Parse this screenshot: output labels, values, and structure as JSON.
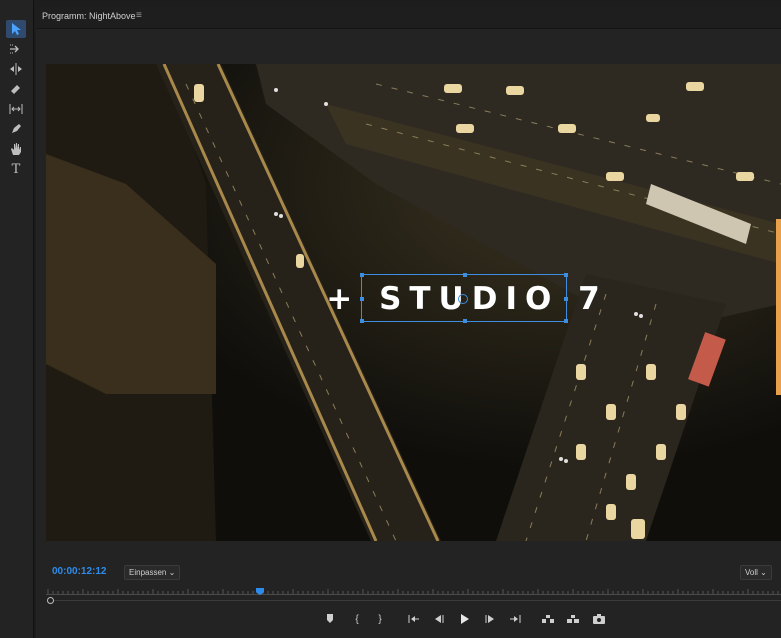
{
  "panel": {
    "title": "Programm: NightAbove",
    "menu_icon": "hamburger-icon"
  },
  "tools": [
    {
      "name": "selection-tool",
      "icon": "arrow-icon",
      "active": true
    },
    {
      "name": "track-select-tool",
      "icon": "track-select-icon"
    },
    {
      "name": "ripple-edit-tool",
      "icon": "ripple-edit-icon"
    },
    {
      "name": "razor-tool",
      "icon": "razor-icon"
    },
    {
      "name": "slip-tool",
      "icon": "slip-icon"
    },
    {
      "name": "pen-tool",
      "icon": "pen-icon"
    },
    {
      "name": "hand-tool",
      "icon": "hand-icon"
    },
    {
      "name": "type-tool",
      "icon": "type-icon",
      "label": "T"
    }
  ],
  "video": {
    "title_text": "+ STUDIO 7"
  },
  "controls": {
    "timecode": "00:00:12:12",
    "fit": "Einpassen",
    "quality": "Voll"
  },
  "colors": {
    "accent": "#2d8ceb",
    "selection": "#3d8de0",
    "panel_bg": "#232323",
    "orange_marker": "#e8a14a"
  }
}
